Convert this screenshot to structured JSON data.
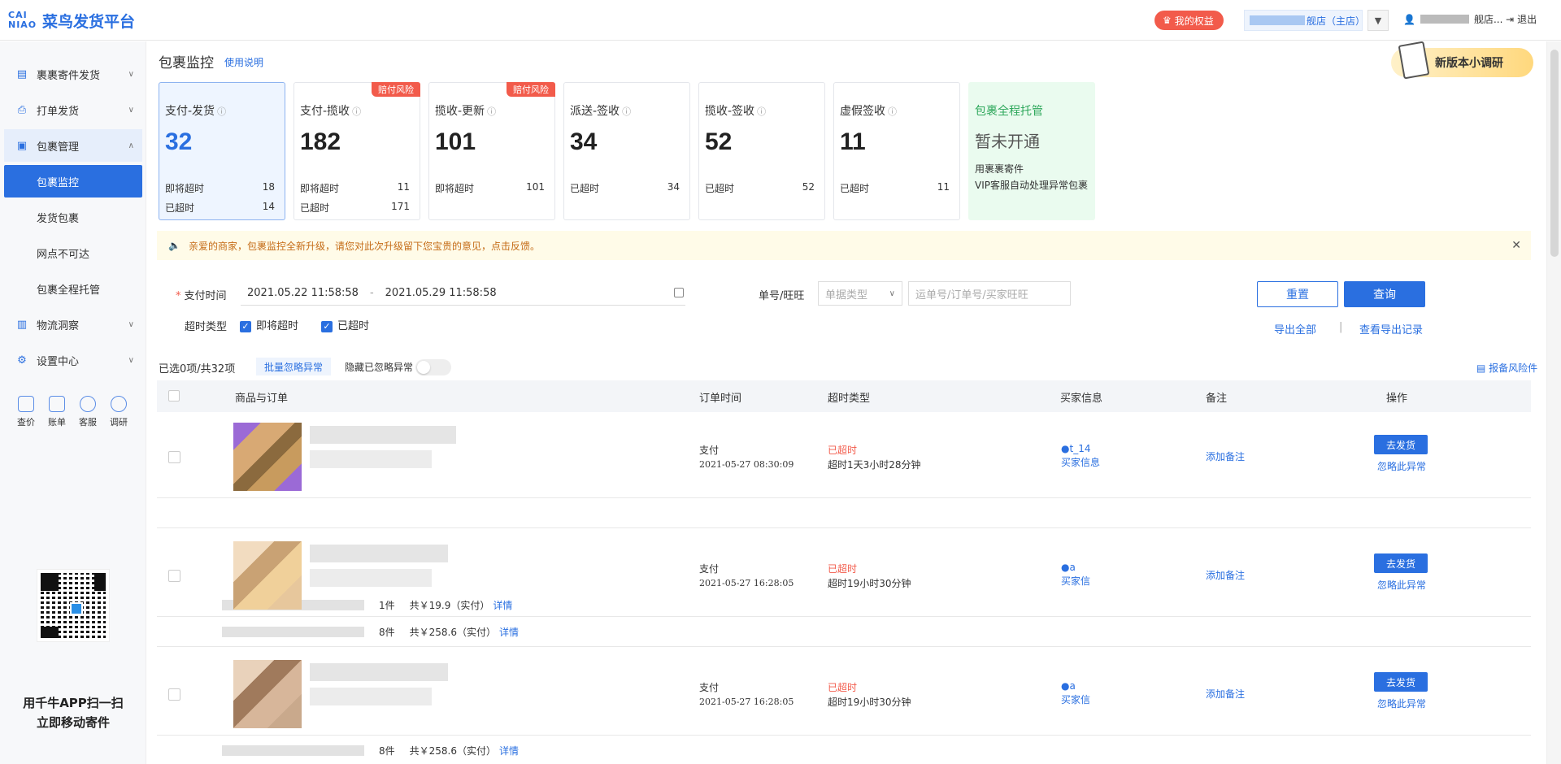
{
  "app": {
    "logo_mark": "CAI NIAO",
    "logo_text": "菜鸟发货平台",
    "rights_label": "我的权益",
    "shop_label": "舰店（主店）",
    "user_label": "舰店...",
    "logout_label": "退出"
  },
  "sidebar": {
    "items": [
      {
        "label": "裹裹寄件发货",
        "icon": "box-icon"
      },
      {
        "label": "打单发货",
        "icon": "printer-icon"
      },
      {
        "label": "包裹管理",
        "icon": "package-icon"
      },
      {
        "label": "物流洞察",
        "icon": "bar-chart-icon"
      },
      {
        "label": "设置中心",
        "icon": "gear-icon"
      }
    ],
    "sub_items": [
      "包裹监控",
      "发货包裹",
      "网点不可达",
      "包裹全程托管"
    ],
    "tools": [
      "查价",
      "账单",
      "客服",
      "调研"
    ],
    "qr_text_1": "用千牛APP扫一扫",
    "qr_text_2": "立即移动寄件"
  },
  "header": {
    "title": "包裹监控",
    "usage_link": "使用说明",
    "survey": "新版本小调研"
  },
  "cards": [
    {
      "title": "支付-发货",
      "value": "32",
      "r1_label": "即将超时",
      "r1_value": "18",
      "r2_label": "已超时",
      "r2_value": "14"
    },
    {
      "title": "支付-揽收",
      "value": "182",
      "badge": "赔付风险",
      "r1_label": "即将超时",
      "r1_value": "11",
      "r2_label": "已超时",
      "r2_value": "171"
    },
    {
      "title": "揽收-更新",
      "value": "101",
      "badge": "赔付风险",
      "r1_label": "即将超时",
      "r1_value": "101"
    },
    {
      "title": "派送-签收",
      "value": "34",
      "r1_label": "已超时",
      "r1_value": "34"
    },
    {
      "title": "揽收-签收",
      "value": "52",
      "r1_label": "已超时",
      "r1_value": "52"
    },
    {
      "title": "虚假签收",
      "value": "11",
      "r1_label": "已超时",
      "r1_value": "11"
    },
    {
      "title": "包裹全程托管",
      "sub": "暂未开通",
      "text": "用裹裹寄件\nVIP客服自动处理异常包裹"
    }
  ],
  "notice": "亲爱的商家，包裹监控全新升级，请您对此次升级留下您宝贵的意见，点击反馈。",
  "filters": {
    "pay_time_label": "支付时间",
    "date_start": "2021.05.22 11:58:58",
    "date_end": "2021.05.29 11:58:58",
    "order_label": "单号/旺旺",
    "type_placeholder": "单据类型",
    "search_placeholder": "运单号/订单号/买家旺旺",
    "timeout_label": "超时类型",
    "opt1": "即将超时",
    "opt2": "已超时",
    "reset": "重置",
    "query": "查询",
    "export_all": "导出全部",
    "export_sep": "|",
    "export_records": "查看导出记录"
  },
  "toolbar": {
    "selected": "已选0项/共32项",
    "batch": "批量忽略异常",
    "hide": "隐藏已忽略异常",
    "risk_insurance": "报备风险件"
  },
  "table": {
    "headers": [
      "商品与订单",
      "订单时间",
      "超时类型",
      "买家信息",
      "备注",
      "操作"
    ],
    "rows": [
      {
        "pay": "支付",
        "time": "2021-05-27 08:30:09",
        "status": "已超时",
        "detail": "超时1天3小时28分钟",
        "buyer": "t_14",
        "buyer_info": "买家信息",
        "note": "添加备注",
        "action": "去发货",
        "ignore": "忽略此异常",
        "count": "1件",
        "total": "共￥19.9（实付）",
        "more": "详情"
      },
      {
        "pay": "支付",
        "time": "2021-05-27 16:28:05",
        "status": "已超时",
        "detail": "超时19小时30分钟",
        "buyer": "a",
        "buyer_info": "买家信",
        "note": "添加备注",
        "action": "去发货",
        "ignore": "忽略此异常",
        "count": "8件",
        "total": "共￥258.6（实付）",
        "more": "详情"
      },
      {
        "pay": "支付",
        "time": "2021-05-27 16:28:05",
        "status": "已超时",
        "detail": "超时19小时30分钟",
        "buyer": "a",
        "buyer_info": "买家信",
        "note": "添加备注",
        "action": "去发货",
        "ignore": "忽略此异常",
        "count": "8件",
        "total": "共￥258.6（实付）",
        "more": "详情"
      }
    ]
  }
}
